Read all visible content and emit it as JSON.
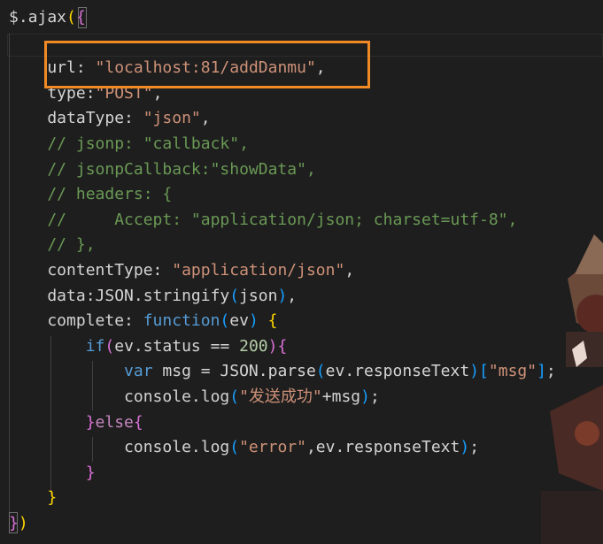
{
  "editor": {
    "theme_colors": {
      "background": "#1e1e1e",
      "highlight_box": "#f08a24",
      "string": "#ce9178",
      "comment": "#6a9955",
      "keyword": "#569cd6",
      "control": "#c586c0",
      "number": "#b5cea8"
    },
    "lines": [
      {
        "tokens": [
          {
            "t": "$.ajax",
            "c": "t-plain"
          },
          {
            "t": "(",
            "c": "t-brk1"
          },
          {
            "t": "{",
            "c": "t-brk2"
          }
        ]
      },
      {
        "tokens": []
      },
      {
        "tokens": [
          {
            "t": "    url: ",
            "c": "t-plain"
          },
          {
            "t": "\"localhost:81/addDanmu\"",
            "c": "t-str"
          },
          {
            "t": ",",
            "c": "t-plain"
          }
        ]
      },
      {
        "tokens": [
          {
            "t": "    type:",
            "c": "t-plain"
          },
          {
            "t": "\"POST\"",
            "c": "t-str"
          },
          {
            "t": ",",
            "c": "t-plain"
          }
        ]
      },
      {
        "tokens": [
          {
            "t": "    dataType: ",
            "c": "t-plain"
          },
          {
            "t": "\"json\"",
            "c": "t-str"
          },
          {
            "t": ",",
            "c": "t-plain"
          }
        ]
      },
      {
        "tokens": [
          {
            "t": "    // jsonp: \"callback\",",
            "c": "t-cmt"
          }
        ]
      },
      {
        "tokens": [
          {
            "t": "    // jsonpCallback:\"showData\",",
            "c": "t-cmt"
          }
        ]
      },
      {
        "tokens": [
          {
            "t": "    // headers: {",
            "c": "t-cmt"
          }
        ]
      },
      {
        "tokens": [
          {
            "t": "    //     Accept: \"application/json; charset=utf-8\",",
            "c": "t-cmt"
          }
        ]
      },
      {
        "tokens": [
          {
            "t": "    // },",
            "c": "t-cmt"
          }
        ]
      },
      {
        "tokens": [
          {
            "t": "    contentType: ",
            "c": "t-plain"
          },
          {
            "t": "\"application/json\"",
            "c": "t-str"
          },
          {
            "t": ",",
            "c": "t-plain"
          }
        ]
      },
      {
        "tokens": [
          {
            "t": "    data:JSON.stringify",
            "c": "t-plain"
          },
          {
            "t": "(",
            "c": "t-brk3"
          },
          {
            "t": "json",
            "c": "t-plain"
          },
          {
            "t": ")",
            "c": "t-brk3"
          },
          {
            "t": ",",
            "c": "t-plain"
          }
        ]
      },
      {
        "tokens": [
          {
            "t": "    complete: ",
            "c": "t-plain"
          },
          {
            "t": "function",
            "c": "t-kw"
          },
          {
            "t": "(",
            "c": "t-brk3"
          },
          {
            "t": "ev",
            "c": "t-plain"
          },
          {
            "t": ")",
            "c": "t-brk3"
          },
          {
            "t": " ",
            "c": "t-plain"
          },
          {
            "t": "{",
            "c": "t-brk1"
          }
        ]
      },
      {
        "tokens": [
          {
            "t": "        ",
            "c": "t-plain"
          },
          {
            "t": "if",
            "c": "t-kw"
          },
          {
            "t": "(",
            "c": "t-brk2"
          },
          {
            "t": "ev.status == ",
            "c": "t-plain"
          },
          {
            "t": "200",
            "c": "t-num"
          },
          {
            "t": ")",
            "c": "t-brk2"
          },
          {
            "t": "{",
            "c": "t-brk2"
          }
        ]
      },
      {
        "tokens": [
          {
            "t": "            ",
            "c": "t-plain"
          },
          {
            "t": "var",
            "c": "t-kw"
          },
          {
            "t": " msg = JSON.parse",
            "c": "t-plain"
          },
          {
            "t": "(",
            "c": "t-brk3"
          },
          {
            "t": "ev.responseText",
            "c": "t-plain"
          },
          {
            "t": ")",
            "c": "t-brk3"
          },
          {
            "t": "[",
            "c": "t-brk3"
          },
          {
            "t": "\"msg\"",
            "c": "t-str"
          },
          {
            "t": "]",
            "c": "t-brk3"
          },
          {
            "t": ";",
            "c": "t-plain"
          }
        ]
      },
      {
        "tokens": [
          {
            "t": "            console.log",
            "c": "t-plain"
          },
          {
            "t": "(",
            "c": "t-brk3"
          },
          {
            "t": "\"发送成功\"",
            "c": "t-str"
          },
          {
            "t": "+msg",
            "c": "t-plain"
          },
          {
            "t": ")",
            "c": "t-brk3"
          },
          {
            "t": ";",
            "c": "t-plain"
          }
        ]
      },
      {
        "tokens": [
          {
            "t": "        ",
            "c": "t-plain"
          },
          {
            "t": "}",
            "c": "t-brk2"
          },
          {
            "t": "else",
            "c": "t-ctl"
          },
          {
            "t": "{",
            "c": "t-brk2"
          }
        ]
      },
      {
        "tokens": [
          {
            "t": "            console.log",
            "c": "t-plain"
          },
          {
            "t": "(",
            "c": "t-brk3"
          },
          {
            "t": "\"error\"",
            "c": "t-str"
          },
          {
            "t": ",ev.responseText",
            "c": "t-plain"
          },
          {
            "t": ")",
            "c": "t-brk3"
          },
          {
            "t": ";",
            "c": "t-plain"
          }
        ]
      },
      {
        "tokens": [
          {
            "t": "        ",
            "c": "t-plain"
          },
          {
            "t": "}",
            "c": "t-brk2"
          }
        ]
      },
      {
        "tokens": [
          {
            "t": "    ",
            "c": "t-plain"
          },
          {
            "t": "}",
            "c": "t-brk1"
          }
        ]
      },
      {
        "tokens": [
          {
            "t": "}",
            "c": "t-brk2"
          },
          {
            "t": ")",
            "c": "t-brk1"
          }
        ]
      }
    ]
  },
  "decoration": {
    "mascot_icon": "anime-character-mascot-icon"
  }
}
